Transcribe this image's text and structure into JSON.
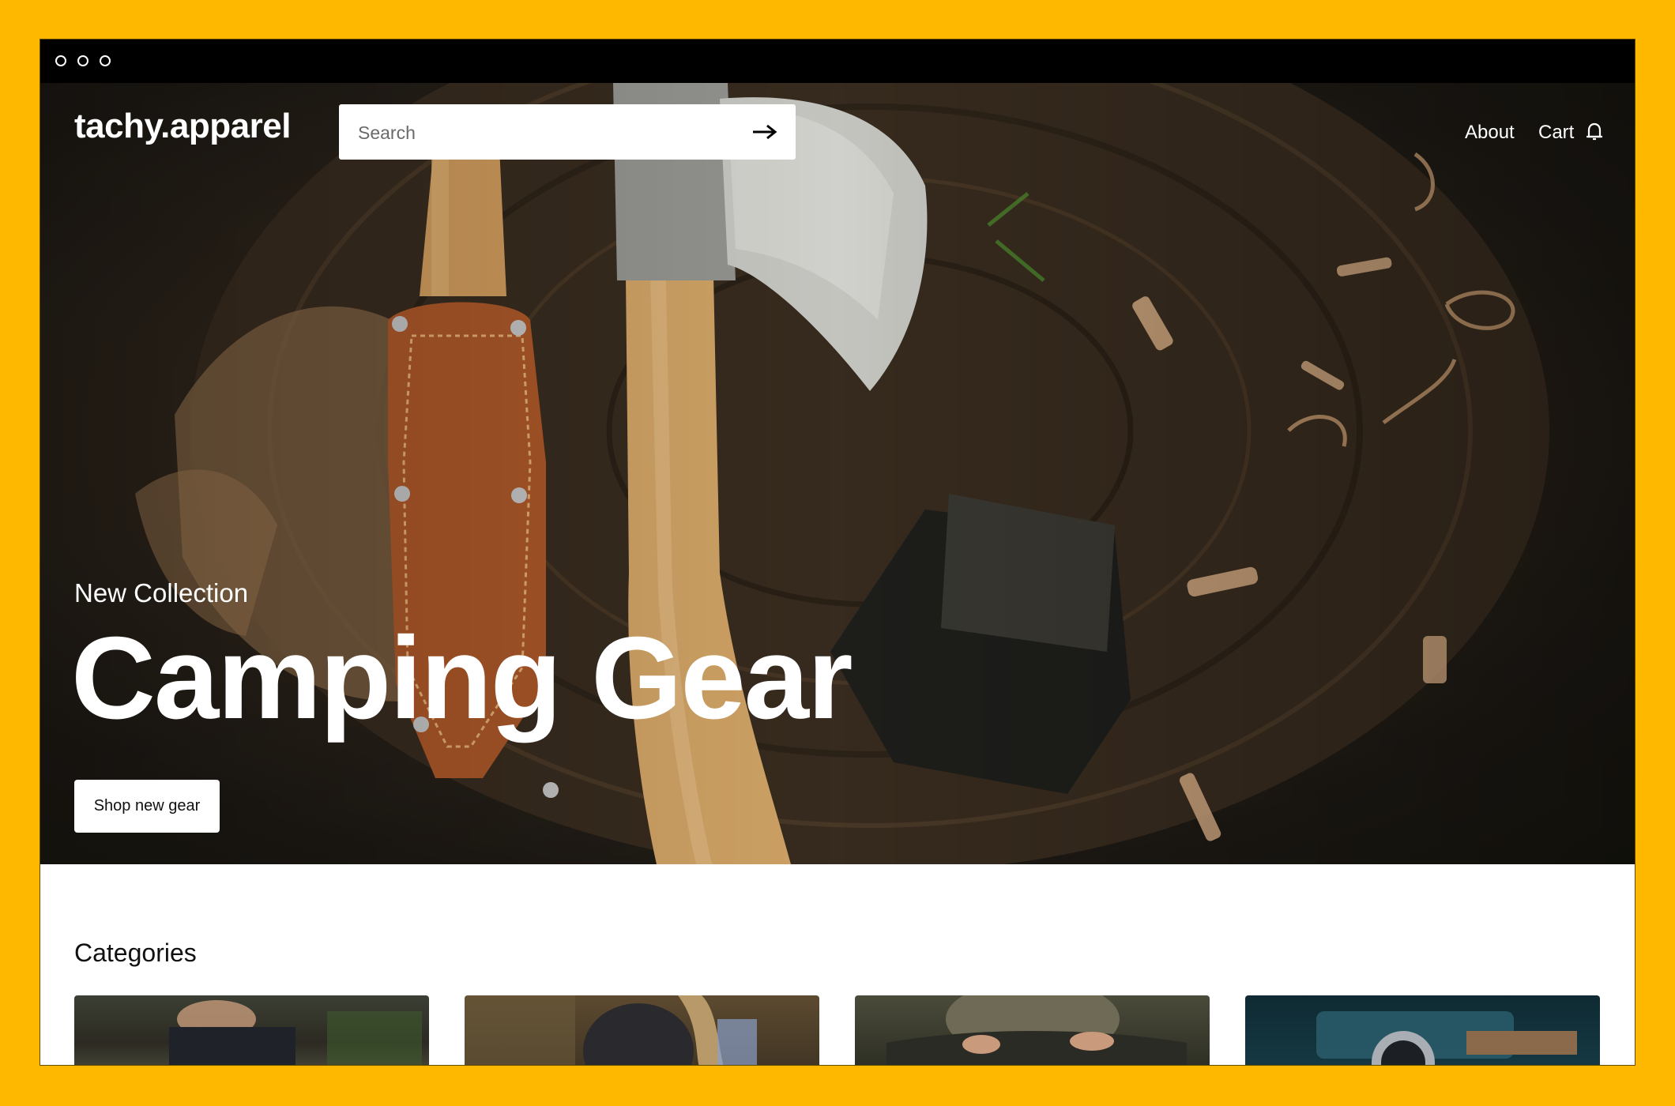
{
  "site": {
    "logo": "tachy.apparel",
    "search": {
      "placeholder": "Search"
    },
    "nav": {
      "about": "About",
      "cart": "Cart"
    }
  },
  "hero": {
    "eyebrow": "New Collection",
    "headline": "Camping Gear",
    "cta": "Shop new gear"
  },
  "categories": {
    "title": "Categories",
    "count_visible": 4
  },
  "icons": {
    "window_controls": [
      "circle-icon",
      "circle-icon",
      "circle-icon"
    ],
    "search_submit": "arrow-right-icon",
    "cart": "bell-icon"
  },
  "colors": {
    "page_background": "#FFB800",
    "titlebar": "#000000",
    "text_on_hero": "#FFFFFF"
  }
}
